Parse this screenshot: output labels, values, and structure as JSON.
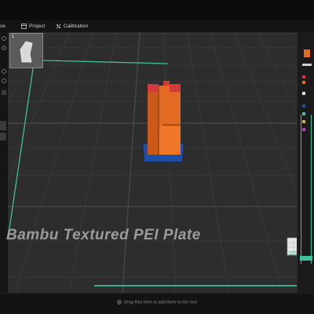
{
  "tabs": [
    {
      "label": "ce",
      "icon": "prepare-icon"
    },
    {
      "label": "Project",
      "icon": "project-icon"
    },
    {
      "label": "Calibration",
      "icon": "calibration-icon"
    }
  ],
  "plate": {
    "label": "Bambu Textured PEI Plate",
    "thumbnail_label": "1"
  },
  "bottom": {
    "hint": "Drag files here to add them to the root",
    "icon": "add-circle-icon"
  },
  "colors": {
    "viewport_bg": "#2d2d2d",
    "model_orange": "#e26a23",
    "model_blue_base": "#1f4fa8",
    "model_red_top": "#d23a3a",
    "accent_green": "#3fbf9a"
  }
}
